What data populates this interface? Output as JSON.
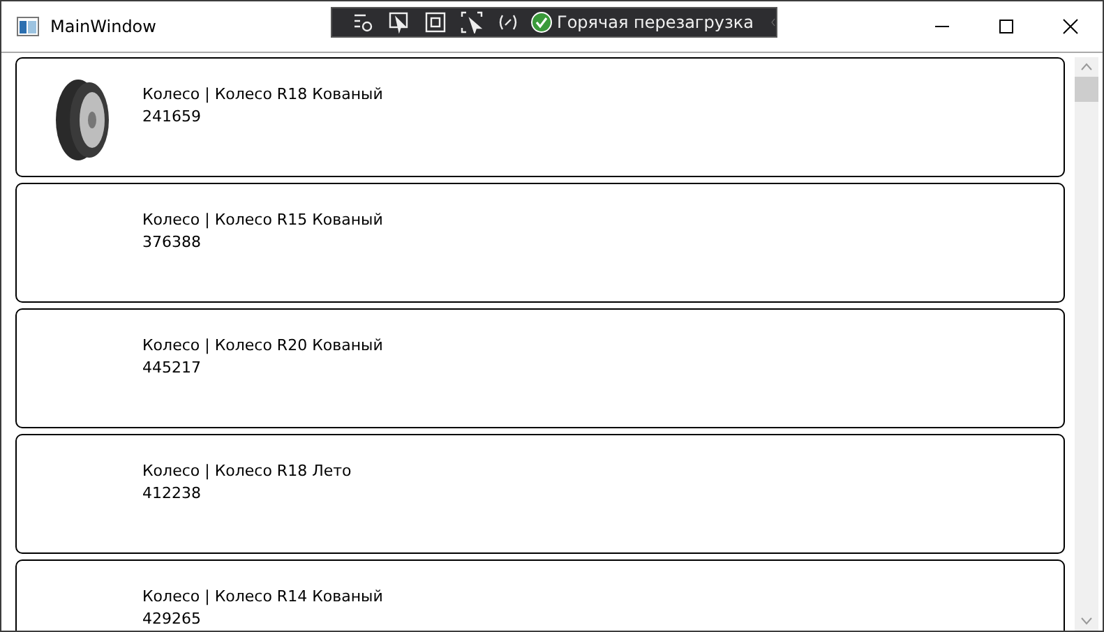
{
  "window": {
    "title": "MainWindow"
  },
  "dev_toolbar": {
    "hot_reload_label": "Горячая перезагрузка"
  },
  "products": [
    {
      "title": "Колесо | Колесо R18 Кованый",
      "article": "241659",
      "photo": true
    },
    {
      "title": "Колесо | Колесо R15 Кованый",
      "article": "376388",
      "photo": false
    },
    {
      "title": "Колесо | Колесо R20 Кованый",
      "article": "445217",
      "photo": false
    },
    {
      "title": "Колесо | Колесо R18 Лето",
      "article": "412238",
      "photo": false
    },
    {
      "title": "Колесо | Колесо R14 Кованый",
      "article": "429265",
      "photo": false
    }
  ]
}
